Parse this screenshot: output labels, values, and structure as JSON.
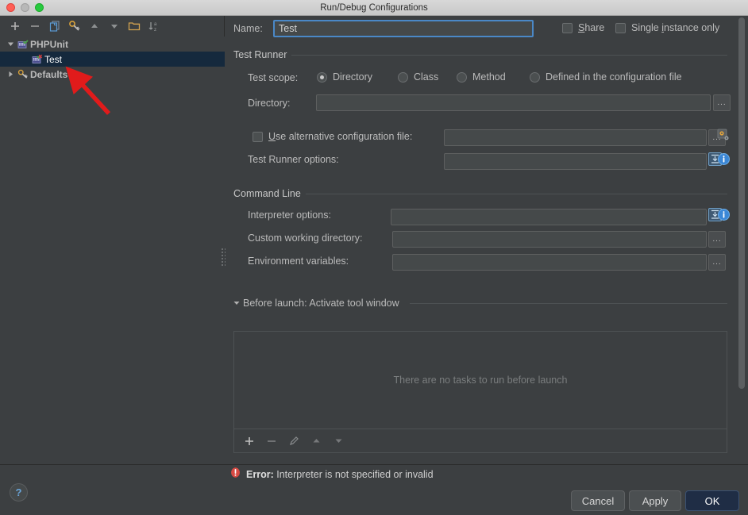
{
  "window": {
    "title": "Run/Debug Configurations",
    "traffic": [
      "close-button",
      "minimize-button",
      "maximize-button"
    ]
  },
  "left_panel": {
    "toolbar": [
      {
        "name": "add-configuration-button",
        "glyph": "+"
      },
      {
        "name": "remove-configuration-button",
        "glyph": "−"
      },
      {
        "name": "copy-configuration-button",
        "glyph": "copy-icon"
      },
      {
        "name": "edit-defaults-button",
        "glyph": "wrench-icon"
      },
      {
        "name": "move-up-button",
        "glyph": "▲"
      },
      {
        "name": "move-down-button",
        "glyph": "▼"
      },
      {
        "name": "folder-button",
        "glyph": "folder-icon"
      },
      {
        "name": "sort-alphabetically-button",
        "glyph": "sort-az-icon"
      }
    ],
    "tree": [
      {
        "label": "PHPUnit",
        "level": 0,
        "expanded": true,
        "selected": false,
        "bold": true,
        "icon": "phpunit-icon"
      },
      {
        "label": "Test",
        "level": 1,
        "expanded": null,
        "selected": true,
        "bold": false,
        "icon": "phpunit-test-icon"
      },
      {
        "label": "Defaults",
        "level": 0,
        "expanded": false,
        "selected": false,
        "bold": true,
        "icon": "wrench-icon"
      }
    ]
  },
  "form": {
    "name_label": "Name:",
    "name_value": "Test",
    "share_label": "Share",
    "share_checked": false,
    "single_instance_label": "Single instance only",
    "single_instance_checked": false,
    "test_runner_section": "Test Runner",
    "test_scope_label": "Test scope:",
    "test_scope_options": [
      {
        "label": "Directory",
        "selected": true
      },
      {
        "label": "Class",
        "selected": false
      },
      {
        "label": "Method",
        "selected": false
      },
      {
        "label": "Defined in the configuration file",
        "selected": false
      }
    ],
    "directory_label": "Directory:",
    "directory_value": "",
    "use_alt_config_label": "Use alternative configuration file:",
    "use_alt_config_checked": false,
    "alt_config_value": "",
    "test_runner_options_label": "Test Runner options:",
    "test_runner_options_value": "",
    "command_line_section": "Command Line",
    "interpreter_options_label": "Interpreter options:",
    "interpreter_options_value": "",
    "custom_working_directory_label": "Custom working directory:",
    "custom_working_directory_value": "",
    "environment_variables_label": "Environment variables:",
    "environment_variables_value": "",
    "ellipsis_label": "...",
    "before_launch_title": "Before launch: Activate tool window",
    "before_launch_empty": "There are no tasks to run before launch",
    "before_launch_toolbar": [
      {
        "name": "before-launch-add-button",
        "glyph": "+"
      },
      {
        "name": "before-launch-remove-button",
        "glyph": "−"
      },
      {
        "name": "before-launch-edit-button",
        "glyph": "pencil-icon"
      },
      {
        "name": "before-launch-move-up-button",
        "glyph": "▲"
      },
      {
        "name": "before-launch-move-down-button",
        "glyph": "▼"
      }
    ]
  },
  "footer": {
    "error_prefix": "Error:",
    "error_message": "Interpreter is not specified or invalid",
    "help_label": "?",
    "cancel_label": "Cancel",
    "apply_label": "Apply",
    "ok_label": "OK"
  },
  "annotation": {
    "arrow_color": "#e11b1b"
  },
  "colors": {
    "panel_bg": "#3c3f41",
    "field_bg": "#45494a",
    "selection_bg": "#15293d",
    "accent": "#4a88c7",
    "error": "#e05252",
    "ok_button_bg": "#1f2d45"
  }
}
